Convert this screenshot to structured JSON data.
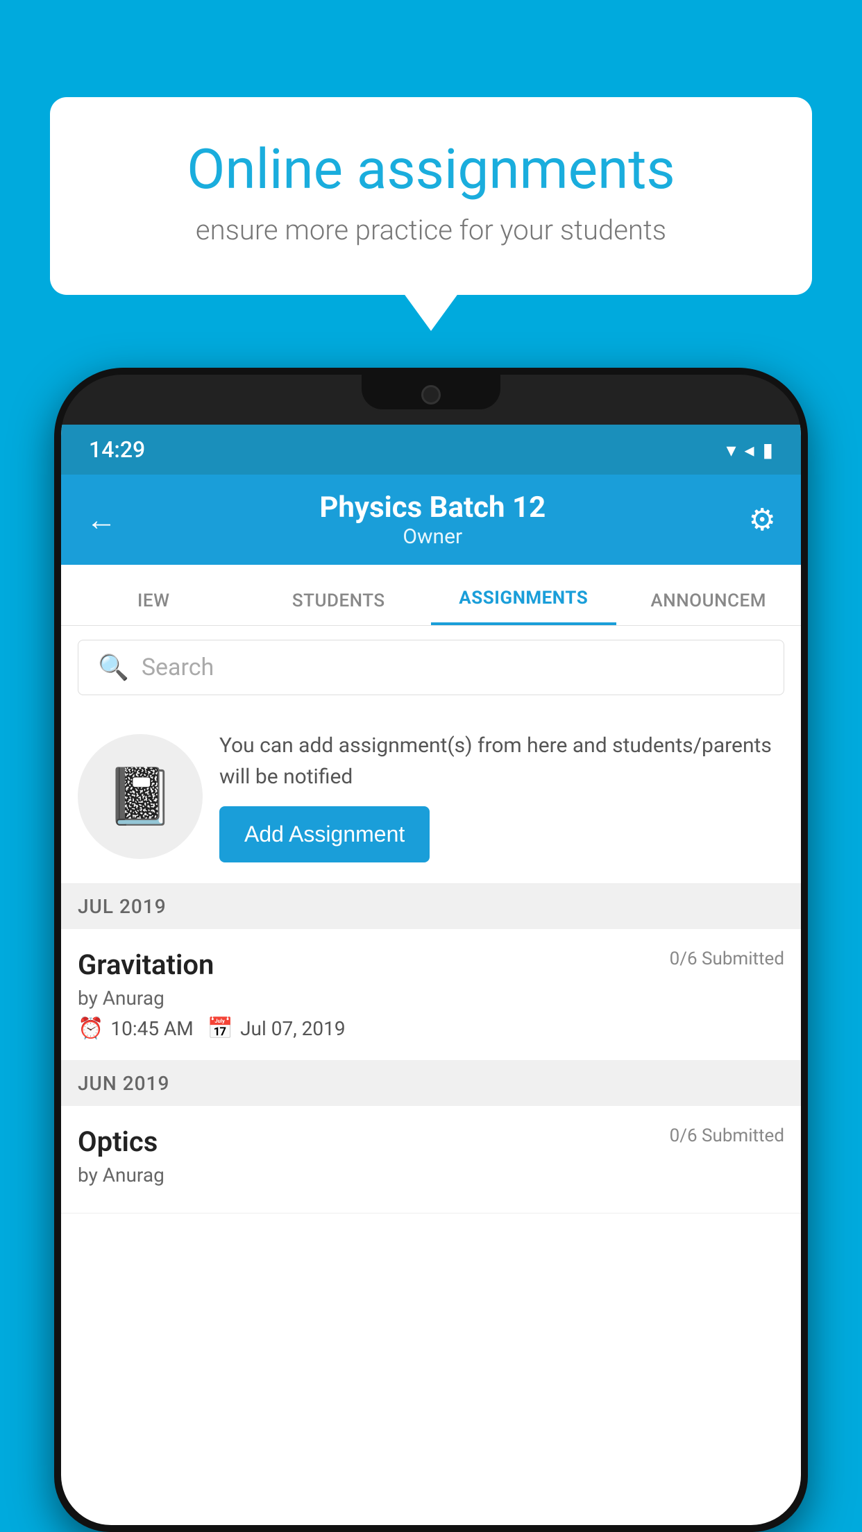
{
  "background": {
    "color": "#00AADD"
  },
  "bubble": {
    "title": "Online assignments",
    "subtitle": "ensure more practice for your students"
  },
  "phone": {
    "status_bar": {
      "time": "14:29",
      "icons": "▾◂▮"
    },
    "header": {
      "title": "Physics Batch 12",
      "subtitle": "Owner",
      "back_label": "←",
      "settings_label": "⚙"
    },
    "tabs": [
      {
        "label": "IEW",
        "active": false
      },
      {
        "label": "STUDENTS",
        "active": false
      },
      {
        "label": "ASSIGNMENTS",
        "active": true
      },
      {
        "label": "ANNOUNCEM",
        "active": false
      }
    ],
    "search": {
      "placeholder": "Search"
    },
    "promo": {
      "text": "You can add assignment(s) from here and students/parents will be notified",
      "button_label": "Add Assignment"
    },
    "sections": [
      {
        "label": "JUL 2019",
        "assignments": [
          {
            "name": "Gravitation",
            "submitted": "0/6 Submitted",
            "author": "by Anurag",
            "time": "10:45 AM",
            "date": "Jul 07, 2019"
          }
        ]
      },
      {
        "label": "JUN 2019",
        "assignments": [
          {
            "name": "Optics",
            "submitted": "0/6 Submitted",
            "author": "by Anurag",
            "time": "",
            "date": ""
          }
        ]
      }
    ]
  }
}
